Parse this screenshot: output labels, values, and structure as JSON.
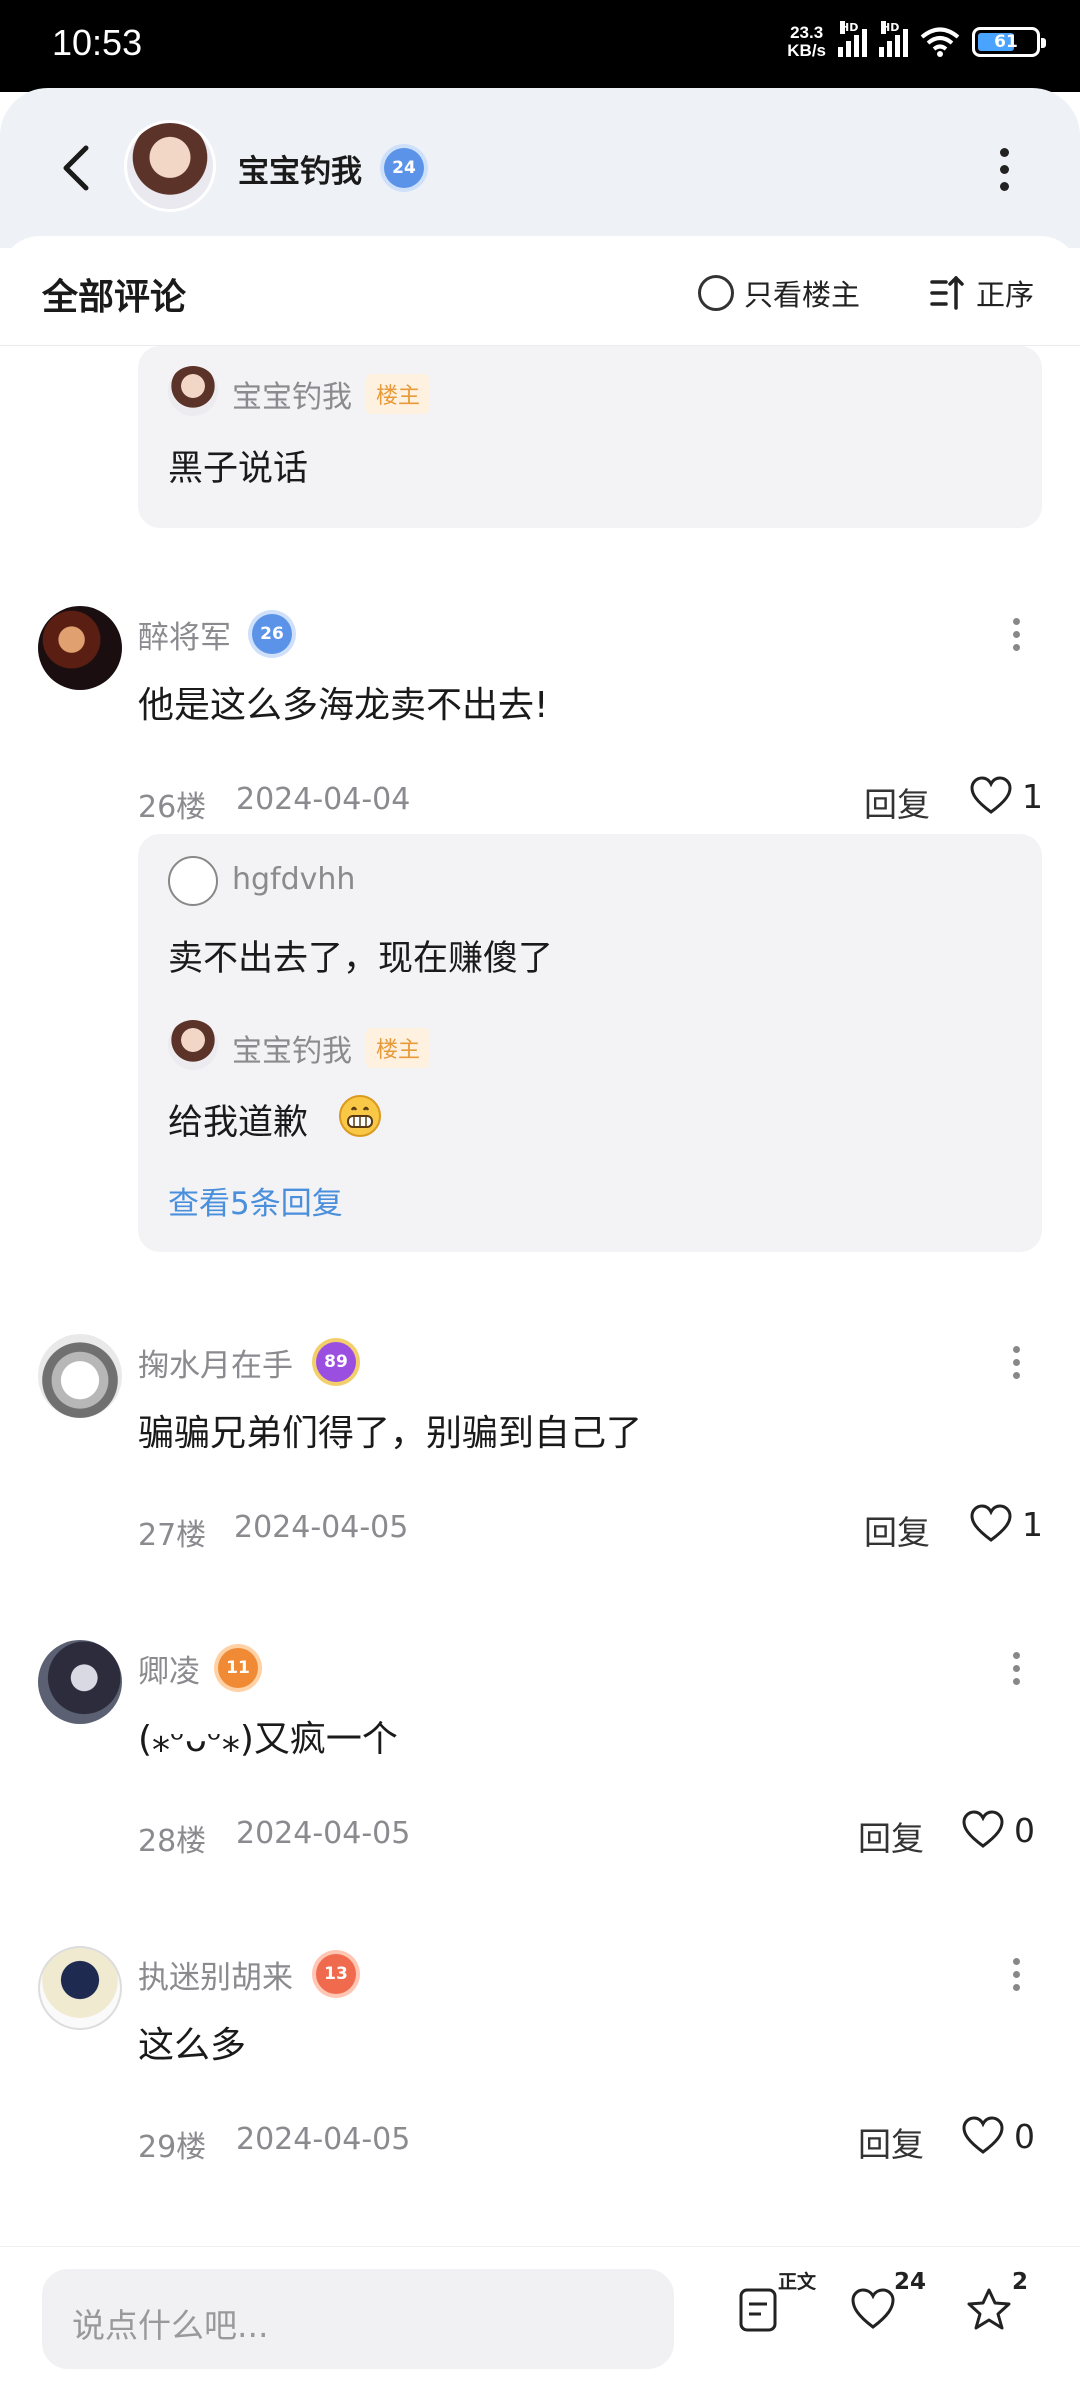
{
  "status_bar": {
    "time": "10:53",
    "net_speed": "23.3",
    "net_unit": "KB/s",
    "signal_hd_1": "HD",
    "signal_hd_2": "HD",
    "battery": "61"
  },
  "header": {
    "author_name": "宝宝钓我",
    "author_level": "24"
  },
  "sort_bar": {
    "title": "全部评论",
    "owner_only_label": "只看楼主",
    "order_label": "正序"
  },
  "top_quote": {
    "name": "宝宝钓我",
    "tag": "楼主",
    "text": "黑子说话"
  },
  "comments": [
    {
      "name": "醉将军",
      "level": "26",
      "text": "他是这么多海龙卖不出去!",
      "floor": "26楼",
      "date": "2024-04-04",
      "reply_label": "回复",
      "likes": "1",
      "replies": [
        {
          "name": "hgfdvhh",
          "text": "卖不出去了，现在赚傻了"
        },
        {
          "name": "宝宝钓我",
          "tag": "楼主",
          "text": "给我道歉"
        }
      ],
      "view_more": "查看5条回复"
    },
    {
      "name": "掬水月在手",
      "level": "89",
      "text": "骗骗兄弟们得了，别骗到自己了",
      "floor": "27楼",
      "date": "2024-04-05",
      "reply_label": "回复",
      "likes": "1"
    },
    {
      "name": "卿凌",
      "level": "11",
      "text": "(⁎ᵕᴗᵕ⁎)又疯一个",
      "floor": "28楼",
      "date": "2024-04-05",
      "reply_label": "回复",
      "likes": "0"
    },
    {
      "name": "执迷别胡来",
      "level": "13",
      "text": "这么多",
      "floor": "29楼",
      "date": "2024-04-05",
      "reply_label": "回复",
      "likes": "0"
    }
  ],
  "bottom_bar": {
    "input_placeholder": "说点什么吧...",
    "doc_label": "正文",
    "likes": "24",
    "stars": "2"
  },
  "colors": {
    "link": "#4a8fdc",
    "owner_tag": "#e69a3a",
    "meta": "#8a8a8f"
  }
}
